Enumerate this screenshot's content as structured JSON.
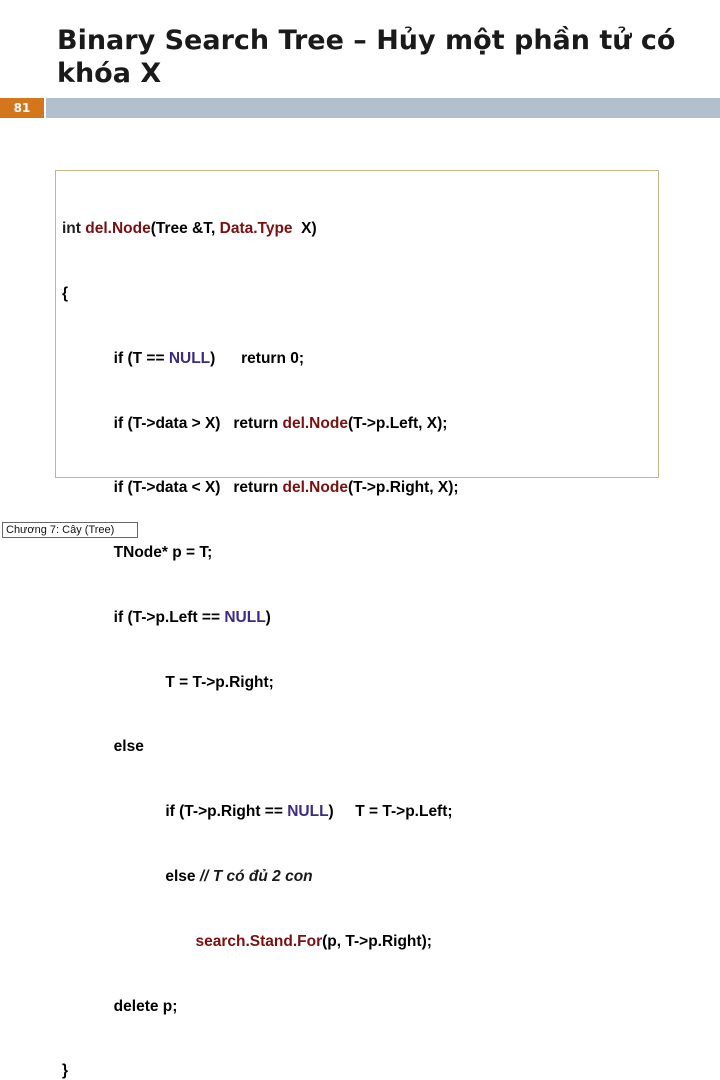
{
  "slide": {
    "title": "Binary Search Tree – Hủy một phần tử có khóa X",
    "page_number": "81",
    "footer": "Chương 7: Cây (Tree)"
  },
  "code": {
    "l1_a": "int ",
    "l1_fn": "del.Node",
    "l1_b": "(Tree &T, ",
    "l1_c": "Data.Type",
    "l1_d": "  X)",
    "l2": "{",
    "l3_a": "            if (T == ",
    "l3_null": "NULL",
    "l3_b": ")      return 0;",
    "l4_a": "            if (T->data > X)   return ",
    "l4_fn": "del.Node",
    "l4_b": "(T->p.Left, X);",
    "l5_a": "            if (T->data < X)   return ",
    "l5_fn": "del.Node",
    "l5_b": "(T->p.Right, X);",
    "l6": "            TNode* p = T;",
    "l7_a": "            if (T->p.Left == ",
    "l7_null": "NULL",
    "l7_b": ")",
    "l8": "                        T = T->p.Right;",
    "l9": "            else",
    "l10_a": "                        if (T->p.Right == ",
    "l10_null": "NULL",
    "l10_b": ")     T = T->p.Left;",
    "l11_a": "                        else ",
    "l11_cm": "// T có đủ 2 con",
    "l12_a": "                               ",
    "l12_fn": "search.Stand.For",
    "l12_b": "(p, T->p.Right);",
    "l13": "            delete p;",
    "l14": "}"
  }
}
